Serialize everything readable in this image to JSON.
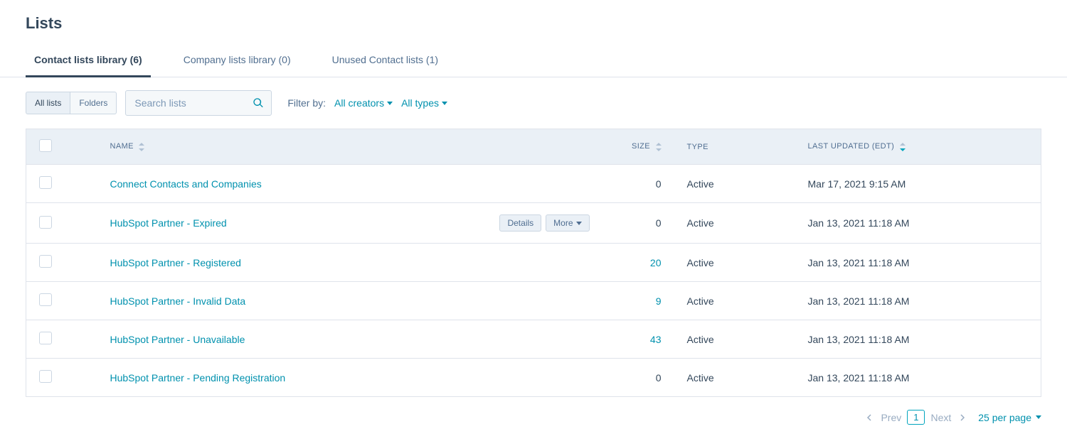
{
  "header": {
    "title": "Lists"
  },
  "tabs": [
    {
      "label": "Contact lists library (6)",
      "active": true
    },
    {
      "label": "Company lists library (0)",
      "active": false
    },
    {
      "label": "Unused Contact lists (1)",
      "active": false
    }
  ],
  "toolbar": {
    "view_all": "All lists",
    "view_folders": "Folders",
    "search_placeholder": "Search lists",
    "filter_label": "Filter by:",
    "filter_creators": "All creators",
    "filter_types": "All types"
  },
  "columns": {
    "name": "Name",
    "size": "Size",
    "type": "Type",
    "last_updated": "Last Updated (EDT)"
  },
  "row_buttons": {
    "details": "Details",
    "more": "More"
  },
  "rows": [
    {
      "name": "Connect Contacts and Companies",
      "size": "0",
      "size_link": false,
      "type": "Active",
      "last_updated": "Mar 17, 2021 9:15 AM",
      "actions": false
    },
    {
      "name": "HubSpot Partner - Expired",
      "size": "0",
      "size_link": false,
      "type": "Active",
      "last_updated": "Jan 13, 2021 11:18 AM",
      "actions": true
    },
    {
      "name": "HubSpot Partner - Registered",
      "size": "20",
      "size_link": true,
      "type": "Active",
      "last_updated": "Jan 13, 2021 11:18 AM",
      "actions": false
    },
    {
      "name": "HubSpot Partner - Invalid Data",
      "size": "9",
      "size_link": true,
      "type": "Active",
      "last_updated": "Jan 13, 2021 11:18 AM",
      "actions": false
    },
    {
      "name": "HubSpot Partner - Unavailable",
      "size": "43",
      "size_link": true,
      "type": "Active",
      "last_updated": "Jan 13, 2021 11:18 AM",
      "actions": false
    },
    {
      "name": "HubSpot Partner - Pending Registration",
      "size": "0",
      "size_link": false,
      "type": "Active",
      "last_updated": "Jan 13, 2021 11:18 AM",
      "actions": false
    }
  ],
  "pagination": {
    "prev": "Prev",
    "next": "Next",
    "current_page": "1",
    "per_page": "25 per page"
  }
}
